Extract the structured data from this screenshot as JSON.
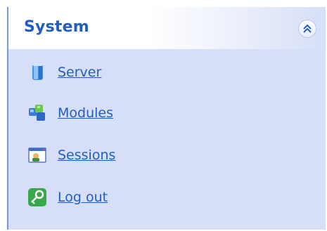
{
  "panel": {
    "title": "System",
    "collapse_icon": "double-chevron-up-icon",
    "items": [
      {
        "label": "Server",
        "icon": "server-icon"
      },
      {
        "label": "Modules",
        "icon": "modules-icon"
      },
      {
        "label": "Sessions",
        "icon": "sessions-icon"
      },
      {
        "label": "Log out",
        "icon": "logout-icon"
      }
    ]
  },
  "colors": {
    "accent": "#215dc6",
    "panel_bg": "#d6dff7",
    "border": "#7a96df"
  }
}
